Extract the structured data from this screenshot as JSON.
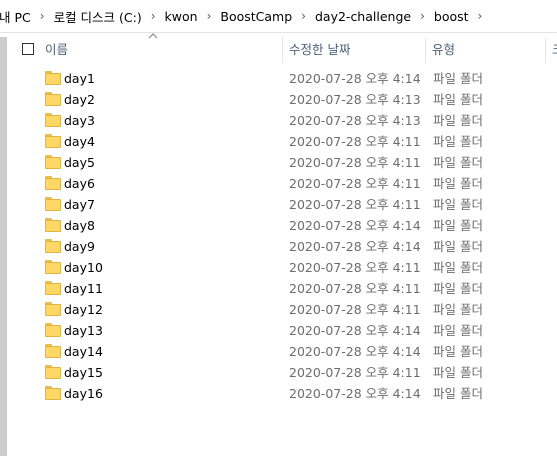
{
  "breadcrumb": [
    "내 PC",
    "로컬 디스크 (C:)",
    "kwon",
    "BoostCamp",
    "day2-challenge",
    "boost"
  ],
  "breadcrumb_separator": "›",
  "columns": {
    "name": "이름",
    "date": "수정한 날짜",
    "type": "유형",
    "extra": "크"
  },
  "rows": [
    {
      "name": "day1",
      "date": "2020-07-28 오후 4:14",
      "type": "파일 폴더"
    },
    {
      "name": "day2",
      "date": "2020-07-28 오후 4:13",
      "type": "파일 폴더"
    },
    {
      "name": "day3",
      "date": "2020-07-28 오후 4:13",
      "type": "파일 폴더"
    },
    {
      "name": "day4",
      "date": "2020-07-28 오후 4:11",
      "type": "파일 폴더"
    },
    {
      "name": "day5",
      "date": "2020-07-28 오후 4:11",
      "type": "파일 폴더"
    },
    {
      "name": "day6",
      "date": "2020-07-28 오후 4:11",
      "type": "파일 폴더"
    },
    {
      "name": "day7",
      "date": "2020-07-28 오후 4:11",
      "type": "파일 폴더"
    },
    {
      "name": "day8",
      "date": "2020-07-28 오후 4:14",
      "type": "파일 폴더"
    },
    {
      "name": "day9",
      "date": "2020-07-28 오후 4:14",
      "type": "파일 폴더"
    },
    {
      "name": "day10",
      "date": "2020-07-28 오후 4:11",
      "type": "파일 폴더"
    },
    {
      "name": "day11",
      "date": "2020-07-28 오후 4:11",
      "type": "파일 폴더"
    },
    {
      "name": "day12",
      "date": "2020-07-28 오후 4:11",
      "type": "파일 폴더"
    },
    {
      "name": "day13",
      "date": "2020-07-28 오후 4:14",
      "type": "파일 폴더"
    },
    {
      "name": "day14",
      "date": "2020-07-28 오후 4:14",
      "type": "파일 폴더"
    },
    {
      "name": "day15",
      "date": "2020-07-28 오후 4:11",
      "type": "파일 폴더"
    },
    {
      "name": "day16",
      "date": "2020-07-28 오후 4:14",
      "type": "파일 폴더"
    }
  ]
}
